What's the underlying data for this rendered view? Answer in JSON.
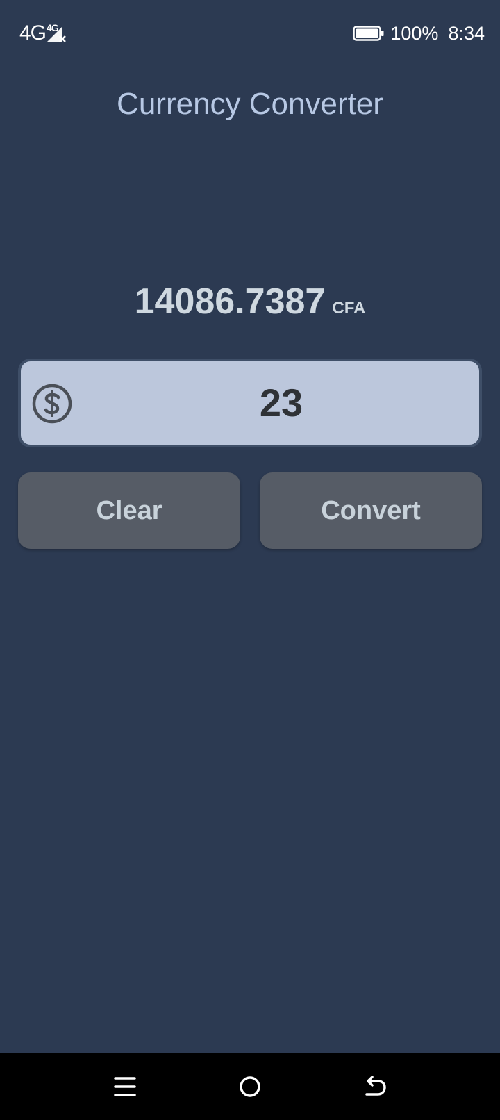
{
  "status_bar": {
    "network": "4G",
    "network_secondary": "4G",
    "battery_percent": "100%",
    "battery_level": 1.0,
    "time": "8:34",
    "icons": [
      "signal-icon",
      "battery-icon"
    ]
  },
  "app": {
    "title": "Currency Converter"
  },
  "result": {
    "value": "14086.7387",
    "unit": "CFA"
  },
  "input": {
    "value": "23",
    "icon": "dollar-circle-icon"
  },
  "buttons": {
    "clear_label": "Clear",
    "convert_label": "Convert"
  },
  "navigation": {
    "icons": [
      "menu-icon",
      "home-icon",
      "back-icon"
    ]
  },
  "colors": {
    "background": "#2c3a52",
    "title": "#b7c8e4",
    "field_background": "#bcc7dc",
    "button_background": "#565c66",
    "button_text": "#c8d2da"
  }
}
